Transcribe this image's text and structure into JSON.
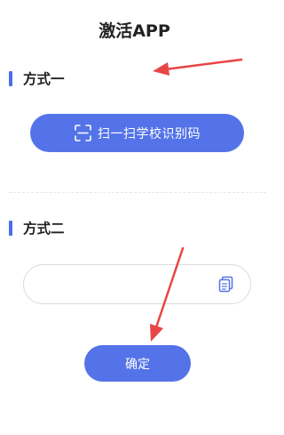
{
  "header": {
    "title": "激活APP"
  },
  "method_one": {
    "label": "方式一",
    "scan_button_label": "扫一扫学校识别码",
    "scan_icon": "scan-frame-icon"
  },
  "method_two": {
    "label": "方式二",
    "input_value": "",
    "input_placeholder": "",
    "paste_icon": "paste-clipboard-icon",
    "confirm_label": "确定"
  },
  "colors": {
    "accent": "#5473e8",
    "section_bar": "#4d6ee8",
    "annotation_arrow": "#e84545"
  }
}
